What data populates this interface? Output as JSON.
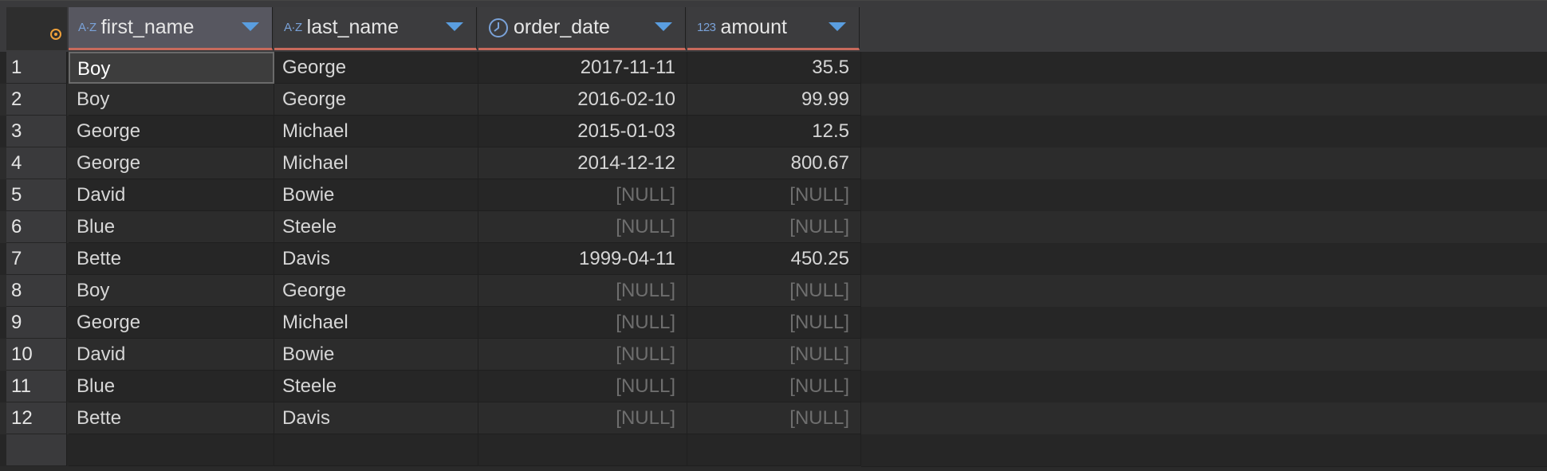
{
  "grid": {
    "columns": [
      {
        "name": "first_name",
        "type_icon": "A·Z",
        "icon_name": "text-type-icon"
      },
      {
        "name": "last_name",
        "type_icon": "A·Z",
        "icon_name": "text-type-icon"
      },
      {
        "name": "order_date",
        "type_icon": "clock",
        "icon_name": "clock-icon"
      },
      {
        "name": "amount",
        "type_icon": "123",
        "icon_name": "numeric-type-icon"
      }
    ],
    "rows": [
      {
        "num": "1",
        "first_name": "Boy",
        "last_name": "George",
        "order_date": "2017-11-11",
        "amount": "35.5"
      },
      {
        "num": "2",
        "first_name": "Boy",
        "last_name": "George",
        "order_date": "2016-02-10",
        "amount": "99.99"
      },
      {
        "num": "3",
        "first_name": "George",
        "last_name": "Michael",
        "order_date": "2015-01-03",
        "amount": "12.5"
      },
      {
        "num": "4",
        "first_name": "George",
        "last_name": "Michael",
        "order_date": "2014-12-12",
        "amount": "800.67"
      },
      {
        "num": "5",
        "first_name": "David",
        "last_name": "Bowie",
        "order_date": "[NULL]",
        "amount": "[NULL]"
      },
      {
        "num": "6",
        "first_name": "Blue",
        "last_name": "Steele",
        "order_date": "[NULL]",
        "amount": "[NULL]"
      },
      {
        "num": "7",
        "first_name": "Bette",
        "last_name": "Davis",
        "order_date": "1999-04-11",
        "amount": "450.25"
      },
      {
        "num": "8",
        "first_name": "Boy",
        "last_name": "George",
        "order_date": "[NULL]",
        "amount": "[NULL]"
      },
      {
        "num": "9",
        "first_name": "George",
        "last_name": "Michael",
        "order_date": "[NULL]",
        "amount": "[NULL]"
      },
      {
        "num": "10",
        "first_name": "David",
        "last_name": "Bowie",
        "order_date": "[NULL]",
        "amount": "[NULL]"
      },
      {
        "num": "11",
        "first_name": "Blue",
        "last_name": "Steele",
        "order_date": "[NULL]",
        "amount": "[NULL]"
      },
      {
        "num": "12",
        "first_name": "Bette",
        "last_name": "Davis",
        "order_date": "[NULL]",
        "amount": "[NULL]"
      }
    ],
    "null_label": "[NULL]",
    "colors": {
      "accent": "#5a9ee0",
      "header_underline": "#c86a5c",
      "row_indicator": "#f0a13a",
      "null_text": "#6e6e6e"
    }
  }
}
